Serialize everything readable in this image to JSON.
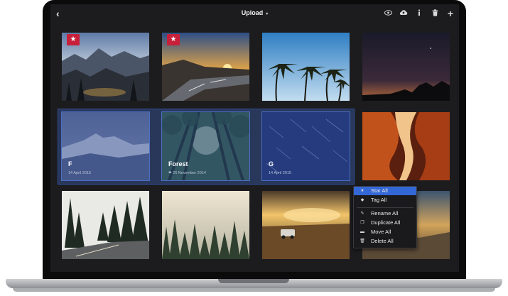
{
  "header": {
    "back_icon": "chevron-left-icon",
    "title": "Upload",
    "caret": "▾",
    "icons": [
      "eye-icon",
      "cloud-upload-icon",
      "info-icon",
      "trash-icon",
      "plus-icon"
    ]
  },
  "photos": [
    {
      "id": "mountain-sunset",
      "starred": true
    },
    {
      "id": "road-sunset",
      "starred": true
    },
    {
      "id": "palm-trees",
      "starred": false
    },
    {
      "id": "night-silhouette",
      "starred": false
    },
    {
      "id": "snow-mountain",
      "caption": "F",
      "date": "14 April 2015",
      "selected": true
    },
    {
      "id": "forest",
      "caption": "Forest",
      "date": "26 November 2014",
      "selected": true,
      "date_icon": "heart-icon"
    },
    {
      "id": "star-trails",
      "caption": "G",
      "date": "14 April 2015",
      "selected": true
    },
    {
      "id": "canyon",
      "starred": false
    },
    {
      "id": "pine-road",
      "starred": false
    },
    {
      "id": "foggy-forest",
      "starred": false
    },
    {
      "id": "desert-car",
      "starred": false
    },
    {
      "id": "coastal-sunset",
      "starred": false
    }
  ],
  "context_menu": {
    "items": [
      {
        "label": "Star All",
        "icon": "star-icon",
        "active": true
      },
      {
        "label": "Tag All",
        "icon": "tag-icon"
      },
      {
        "label": "Rename All",
        "icon": "pencil-icon"
      },
      {
        "label": "Duplicate All",
        "icon": "duplicate-icon"
      },
      {
        "label": "Move All",
        "icon": "folder-icon"
      },
      {
        "label": "Delete All",
        "icon": "trash-icon"
      }
    ]
  },
  "colors": {
    "accent": "#3467d6",
    "selection": "#344e8c",
    "star_badge": "#c8203a",
    "background": "#1c1c1e"
  }
}
